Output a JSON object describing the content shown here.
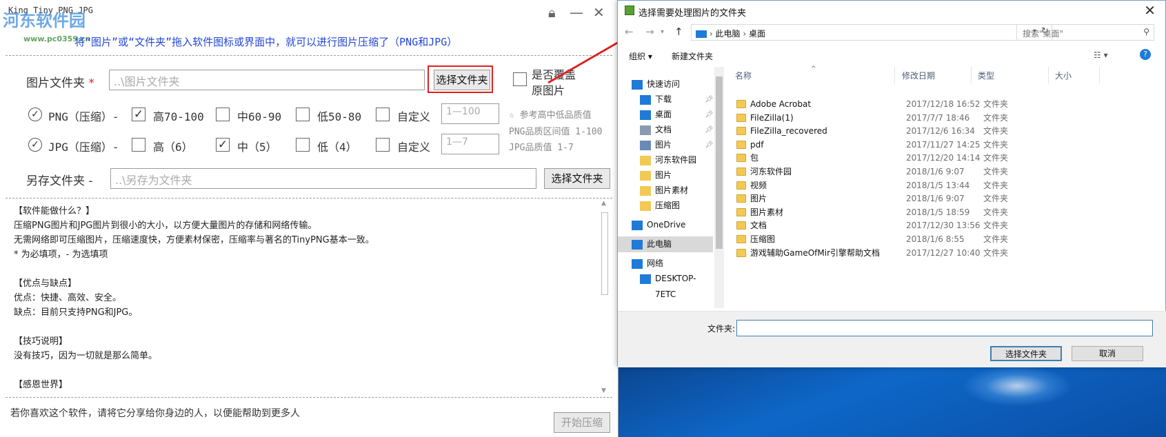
{
  "left": {
    "title": "King Tiny PNG JPG",
    "watermark": "河东软件园",
    "watermark_url": "www.pc0359.cn",
    "hint": "将“图片”或“文件夹”拖入软件图标或界面中，就可以进行图片压缩了（PNG和JPG）",
    "img_folder_label": "图片文件夹",
    "required_mark": "*",
    "img_folder_placeholder": "..\\图片文件夹",
    "choose_folder_btn": "选择文件夹",
    "overwrite_label_1": "是否覆盖",
    "overwrite_label_2": "原图片",
    "png": {
      "label": "PNG（压缩）-",
      "opts": [
        "高70-100",
        "中60-90",
        "低50-80",
        "自定义"
      ],
      "checked": [
        true,
        false,
        false,
        false
      ],
      "custom_placeholder": "1—100"
    },
    "jpg": {
      "label": "JPG（压缩）-",
      "opts": [
        "高（6）",
        "中（5）",
        "低（4）",
        "自定义"
      ],
      "checked": [
        false,
        true,
        false,
        false
      ],
      "custom_placeholder": "1—7"
    },
    "quality_note_1": "☆ 参考高中低品质值",
    "quality_note_2": "PNG品质区间值 1-100",
    "quality_note_3": "JPG品质值 1-7",
    "save_folder_label": "另存文件夹 -",
    "save_folder_placeholder": "..\\另存为文件夹",
    "save_choose_btn": "选择文件夹",
    "info_lines": [
      "【软件能做什么？】",
      "压缩PNG图片和JPG图片到很小的大小，以方便大量图片的存储和网络传输。",
      "无需网络即可压缩图片，压缩速度快，方便素材保密，压缩率与著名的TinyPNG基本一致。",
      "* 为必填项，- 为选填项",
      "",
      "【优点与缺点】",
      "优点：快捷、高效、安全。",
      "缺点：目前只支持PNG和JPG。",
      "",
      "【技巧说明】",
      "没有技巧，因为一切就是那么简单。",
      "",
      "【感恩世界】"
    ],
    "footer": "若你喜欢这个软件，请将它分享给你身边的人，以便能帮助到更多人",
    "start_btn": "开始压缩"
  },
  "dialog": {
    "title": "选择需要处理图片的文件夹",
    "breadcrumb": [
      "此电脑",
      "桌面"
    ],
    "search_placeholder": "搜索\"桌面\"",
    "organize": "组织 ▾",
    "new_folder": "新建文件夹",
    "nav": [
      {
        "label": "快速访问",
        "icon": "star-icon",
        "indent": 0,
        "pin": false
      },
      {
        "label": "下载",
        "icon": "download-icon",
        "indent": 1,
        "pin": true
      },
      {
        "label": "桌面",
        "icon": "desktop-icon",
        "indent": 1,
        "pin": true
      },
      {
        "label": "文档",
        "icon": "document-icon",
        "indent": 1,
        "pin": true
      },
      {
        "label": "图片",
        "icon": "picture-icon",
        "indent": 1,
        "pin": true
      },
      {
        "label": "河东软件园",
        "icon": "folder-icon",
        "indent": 1,
        "pin": false
      },
      {
        "label": "图片",
        "icon": "folder-icon",
        "indent": 1,
        "pin": false
      },
      {
        "label": "图片素材",
        "icon": "folder-icon",
        "indent": 1,
        "pin": false
      },
      {
        "label": "压缩图",
        "icon": "folder-icon",
        "indent": 1,
        "pin": false
      },
      {
        "label": "OneDrive",
        "icon": "cloud-icon",
        "indent": 0,
        "pin": false
      },
      {
        "label": "此电脑",
        "icon": "computer-icon",
        "indent": 0,
        "pin": false,
        "selected": true
      },
      {
        "label": "网络",
        "icon": "network-icon",
        "indent": 0,
        "pin": false
      },
      {
        "label": "DESKTOP-7ETC",
        "icon": "computer-icon",
        "indent": 1,
        "pin": false
      }
    ],
    "columns": [
      "名称",
      "修改日期",
      "类型",
      "大小"
    ],
    "files": [
      {
        "name": "Adobe Acrobat",
        "date": "2017/12/18 16:52",
        "type": "文件夹"
      },
      {
        "name": "FileZilla(1)",
        "date": "2017/7/7 18:46",
        "type": "文件夹"
      },
      {
        "name": "FileZilla_recovered",
        "date": "2017/12/6 16:34",
        "type": "文件夹"
      },
      {
        "name": "pdf",
        "date": "2017/11/27 14:25",
        "type": "文件夹"
      },
      {
        "name": "包",
        "date": "2017/12/20 14:14",
        "type": "文件夹"
      },
      {
        "name": "河东软件园",
        "date": "2018/1/6 9:07",
        "type": "文件夹"
      },
      {
        "name": "视频",
        "date": "2018/1/5 13:44",
        "type": "文件夹"
      },
      {
        "name": "图片",
        "date": "2018/1/6 9:07",
        "type": "文件夹"
      },
      {
        "name": "图片素材",
        "date": "2018/1/5 18:59",
        "type": "文件夹"
      },
      {
        "name": "文档",
        "date": "2017/12/30 13:56",
        "type": "文件夹"
      },
      {
        "name": "压缩图",
        "date": "2018/1/6 8:55",
        "type": "文件夹"
      },
      {
        "name": "游戏辅助GameOfMir引擎帮助文档",
        "date": "2017/12/27 10:40",
        "type": "文件夹"
      }
    ],
    "folder_label": "文件夹:",
    "folder_value": "",
    "ok_btn": "选择文件夹",
    "cancel_btn": "取消"
  },
  "colors": {
    "accent": "#2346d6",
    "highlight_red": "#e02020",
    "folder": "#f3c955"
  }
}
